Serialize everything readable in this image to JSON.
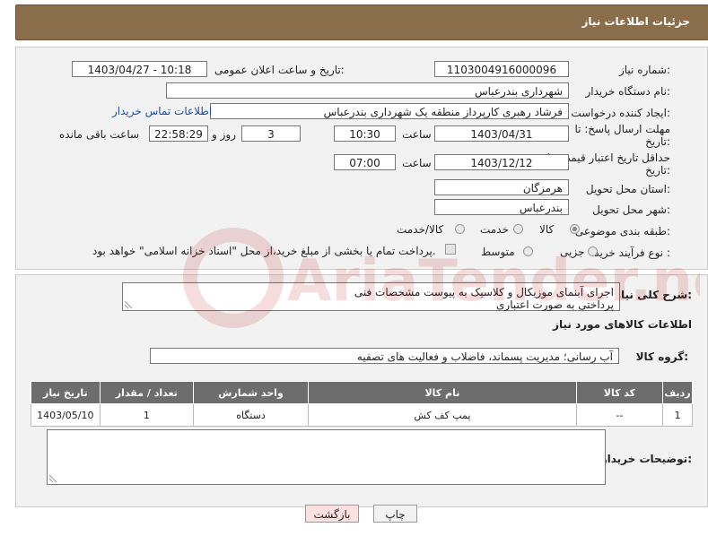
{
  "header": {
    "title": "جزئیات اطلاعات نیاز"
  },
  "form": {
    "need_number": {
      "label": "شماره نیاز:",
      "value": "1103004916000096"
    },
    "announce_datetime": {
      "label": "تاریخ و ساعت اعلان عمومی:",
      "value": "1403/04/27 - 10:18"
    },
    "buyer_org": {
      "label": "نام دستگاه خریدار:",
      "value": "شهرداری بندرعباس"
    },
    "requester": {
      "label": "ایجاد کننده درخواست:",
      "value": "فرشاد رهبری کارپرداز منطقه یک شهرداری بندرعباس",
      "contact_link": "اطلاعات تماس خریدار"
    },
    "reply_deadline": {
      "label1": "مهلت ارسال پاسخ: تا",
      "label2": "تاریخ:",
      "date": "1403/04/31",
      "time_label": "ساعت",
      "time": "10:30",
      "days": "3",
      "days_label": "روز و",
      "remaining": "22:58:29",
      "remaining_label": "ساعت باقی مانده"
    },
    "price_validity": {
      "label1": "حداقل تاریخ اعتبار قیمت: تا",
      "label2": "تاریخ:",
      "date": "1403/12/12",
      "time_label": "ساعت",
      "time": "07:00"
    },
    "province": {
      "label": "استان محل تحویل:",
      "value": "هرمزگان"
    },
    "city": {
      "label": "شهر محل تحویل:",
      "value": "بندرعباس"
    },
    "category": {
      "label": "طبقه بندی موضوعی:",
      "options": [
        "کالا",
        "خدمت",
        "کالا/خدمت"
      ],
      "selected": "کالا"
    },
    "purchase_type": {
      "label": "نوع فرآیند خرید :",
      "options": [
        "جزیی",
        "متوسط"
      ],
      "selected": "",
      "payment_note": "پرداخت تمام یا بخشی از مبلغ خرید،از محل \"اسناد خزانه اسلامی\" خواهد بود."
    }
  },
  "description": {
    "label": "شرح کلی نیاز:",
    "line1": "اجرای آبنمای موزیکال و کلاسیک به پیوست مشخصات فنی",
    "line2": "پرداختی به صورت اعتباری"
  },
  "goods_info": {
    "title": "اطلاعات کالاهای مورد نیاز"
  },
  "goods_group": {
    "label": "گروه کالا:",
    "value": "آب رسانی؛ مدیریت پسماند، فاضلاب و فعالیت های تصفیه"
  },
  "table": {
    "headers": [
      "ردیف",
      "کد کالا",
      "نام کالا",
      "واحد شمارش",
      "تعداد / مقدار",
      "تاریخ نیاز"
    ],
    "rows": [
      [
        "1",
        "--",
        "پمپ کف کش",
        "دستگاه",
        "1",
        "1403/05/10"
      ]
    ]
  },
  "buyer_notes": {
    "label": "توضیحات خریدار:"
  },
  "buttons": {
    "print": "چاپ",
    "back": "بازگشت"
  },
  "watermark": {
    "text": "AriaTender.net"
  },
  "colors": {
    "header_bg": "#8a6d4b",
    "table_header_bg": "#6d6d6d",
    "link": "#1a4fb0",
    "back_button_bg": "#fde0e0"
  }
}
